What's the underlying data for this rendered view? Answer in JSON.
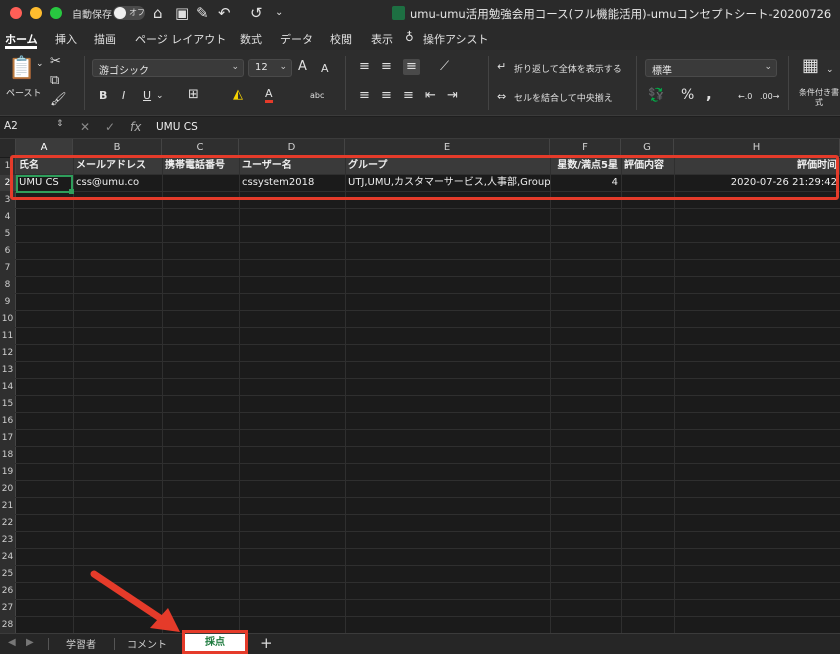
{
  "titlebar": {
    "autosave_label": "自動保存",
    "autosave_state": "オフ",
    "window_title": "umu-umu活用勉強会用コース(フル機能活用)-umuコンセプトシート-20200726"
  },
  "ribbon_tabs": [
    {
      "label": "ホーム",
      "active": true
    },
    {
      "label": "挿入"
    },
    {
      "label": "描画"
    },
    {
      "label": "ページ レイアウト"
    },
    {
      "label": "数式"
    },
    {
      "label": "データ"
    },
    {
      "label": "校閲"
    },
    {
      "label": "表示"
    },
    {
      "label": "操作アシスト"
    }
  ],
  "ribbon": {
    "paste_label": "ペースト",
    "font_name": "游ゴシック",
    "font_size": "12",
    "increase_font": "A",
    "decrease_font": "A",
    "bold": "B",
    "italic": "I",
    "underline": "U",
    "font_color_glyph": "A",
    "abc_glyph": "abc",
    "wrap_text": "折り返して全体を表示する",
    "merge_center": "セルを結合して中央揃え",
    "number_format": "標準",
    "percent": "%",
    "comma": ",",
    "conditional_format": "条件付き書式"
  },
  "formula_bar": {
    "cell_ref": "A2",
    "fx": "fx",
    "value": "UMU CS"
  },
  "columns": [
    "A",
    "B",
    "C",
    "D",
    "E",
    "F",
    "G",
    "H"
  ],
  "header_row": [
    "氏名",
    "メールアドレス",
    "携帯電話番号",
    "ユーザー名",
    "グループ",
    "星数/満点5星",
    "評価内容",
    "評価时间"
  ],
  "data_row": [
    "UMU CS",
    "css@umu.co",
    "",
    "cssystem2018",
    "UTJ,UMU,カスタマーサービス,人事部,Group",
    "4",
    "",
    "2020-07-26 21:29:42"
  ],
  "row_numbers": [
    "1",
    "2",
    "3",
    "4",
    "5",
    "6",
    "7",
    "8",
    "9",
    "10",
    "11",
    "12",
    "13",
    "14",
    "15",
    "16",
    "17",
    "18",
    "19",
    "20",
    "21",
    "22",
    "23",
    "24",
    "25",
    "26",
    "27",
    "28"
  ],
  "sheets": [
    {
      "label": "学習者"
    },
    {
      "label": "コメント"
    },
    {
      "label": "採点",
      "active": true
    }
  ],
  "add_sheet": "+",
  "colors": {
    "highlight": "#e53b2a",
    "active_cell": "#2e9e5b",
    "active_tab_text": "#1d7a3e"
  }
}
